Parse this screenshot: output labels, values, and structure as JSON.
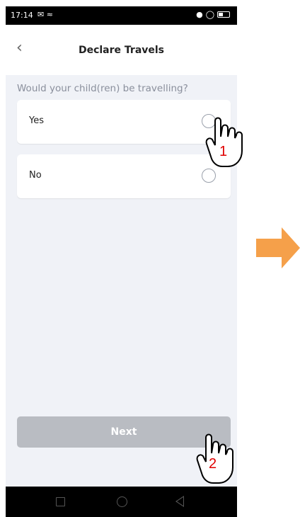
{
  "status_bar": {
    "time": "17:14"
  },
  "header": {
    "title": "Declare Travels",
    "back_icon": "chevron-left-icon"
  },
  "question": "Would your child(ren) be travelling?",
  "options": [
    {
      "label": "Yes",
      "selected": false
    },
    {
      "label": "No",
      "selected": false
    }
  ],
  "next_button": {
    "label": "Next",
    "enabled": false,
    "color": "#b9bcc2"
  },
  "annotations": {
    "step1": "1",
    "step2": "2",
    "arrow_color": "#f5a04a"
  },
  "colors": {
    "background": "#f0f2f7",
    "card": "#ffffff",
    "question_text": "#8a8f9c"
  }
}
